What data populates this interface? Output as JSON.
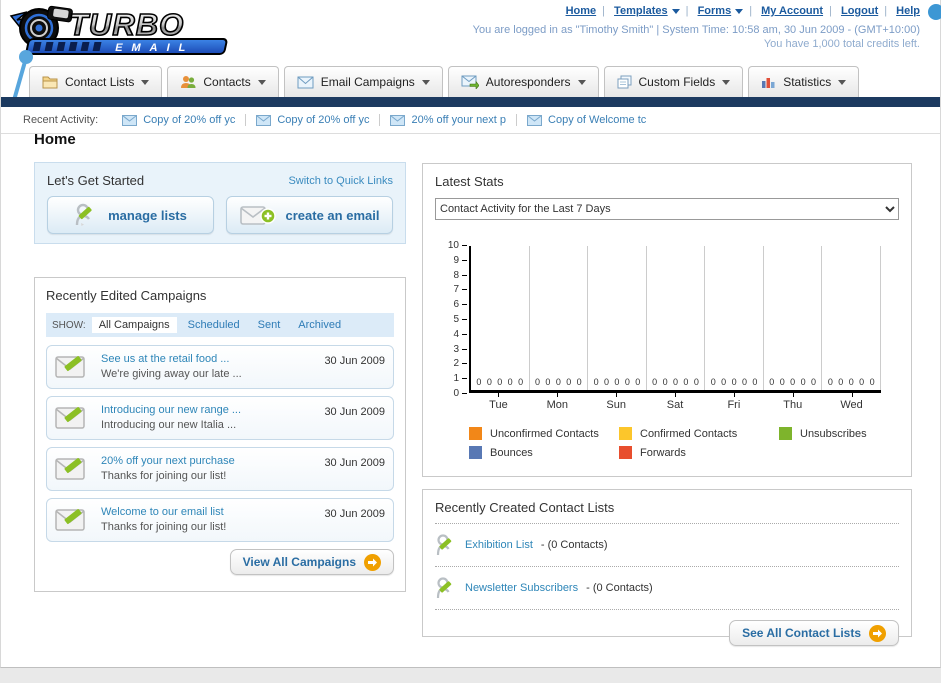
{
  "brand": {
    "name": "TURBO",
    "sub": "EMAIL"
  },
  "header": {
    "nav": [
      {
        "label": "Home",
        "dropdown": false
      },
      {
        "label": "Templates",
        "dropdown": true
      },
      {
        "label": "Forms",
        "dropdown": true
      },
      {
        "label": "My Account",
        "dropdown": false
      },
      {
        "label": "Logout",
        "dropdown": false
      },
      {
        "label": "Help",
        "dropdown": false
      }
    ],
    "status_line1": "You are logged in as \"Timothy Smith\" | System Time: 10:58 am, 30 Jun 2009 - (GMT+10:00)",
    "status_line2": "You have 1,000 total credits left."
  },
  "tabs": [
    {
      "label": "Contact Lists"
    },
    {
      "label": "Contacts"
    },
    {
      "label": "Email Campaigns"
    },
    {
      "label": "Autoresponders"
    },
    {
      "label": "Custom Fields"
    },
    {
      "label": "Statistics"
    }
  ],
  "recent_activity": {
    "label": "Recent Activity:",
    "items": [
      {
        "text": "Copy of 20% off yc"
      },
      {
        "text": "Copy of 20% off yc"
      },
      {
        "text": "20% off your next p"
      },
      {
        "text": "Copy of Welcome tc"
      }
    ]
  },
  "page_title": "Home",
  "get_started": {
    "title": "Let's Get Started",
    "switch_link": "Switch to Quick Links",
    "manage_lists_label": "manage lists",
    "create_email_label": "create an email"
  },
  "campaigns": {
    "title": "Recently Edited Campaigns",
    "show_label": "SHOW:",
    "filters": [
      {
        "label": "All Campaigns"
      },
      {
        "label": "Scheduled"
      },
      {
        "label": "Sent"
      },
      {
        "label": "Archived"
      }
    ],
    "active_filter": "All Campaigns",
    "items": [
      {
        "title": "See us at the retail food ...",
        "subtitle": "We're giving away our late ...",
        "date": "30 Jun 2009"
      },
      {
        "title": "Introducing our new range ...",
        "subtitle": "Introducing our new Italia ...",
        "date": "30 Jun 2009"
      },
      {
        "title": "20% off your next purchase",
        "subtitle": "Thanks for joining our list!",
        "date": "30 Jun 2009"
      },
      {
        "title": "Welcome to our email list",
        "subtitle": "Thanks for joining our list!",
        "date": "30 Jun 2009"
      }
    ],
    "view_all_label": "View All Campaigns"
  },
  "latest_stats": {
    "title": "Latest Stats",
    "dropdown_value": "Contact Activity for the Last 7 Days"
  },
  "chart_data": {
    "type": "bar",
    "title": "Contact Activity for the Last 7 Days",
    "categories": [
      "Tue",
      "Mon",
      "Sun",
      "Sat",
      "Fri",
      "Thu",
      "Wed"
    ],
    "series": [
      {
        "name": "Unconfirmed Contacts",
        "color": "#f28718",
        "values": [
          0,
          0,
          0,
          0,
          0,
          0,
          0
        ]
      },
      {
        "name": "Confirmed Contacts",
        "color": "#fcc62b",
        "values": [
          0,
          0,
          0,
          0,
          0,
          0,
          0
        ]
      },
      {
        "name": "Unsubscribes",
        "color": "#7eb42c",
        "values": [
          0,
          0,
          0,
          0,
          0,
          0,
          0
        ]
      },
      {
        "name": "Bounces",
        "color": "#5878b4",
        "values": [
          0,
          0,
          0,
          0,
          0,
          0,
          0
        ]
      },
      {
        "name": "Forwards",
        "color": "#e84e2e",
        "values": [
          0,
          0,
          0,
          0,
          0,
          0,
          0
        ]
      }
    ],
    "ylim": [
      0,
      10
    ],
    "yticks": [
      10,
      9,
      8,
      7,
      6,
      5,
      4,
      3,
      2,
      1,
      0
    ],
    "value_label_text": "0",
    "legend_position": "bottom",
    "grid": "vertical"
  },
  "contact_lists": {
    "title": "Recently Created Contact Lists",
    "items": [
      {
        "name": "Exhibition List",
        "detail": "- (0 Contacts)"
      },
      {
        "name": "Newsletter Subscribers",
        "detail": "- (0 Contacts)"
      }
    ],
    "see_all_label": "See All Contact Lists"
  }
}
